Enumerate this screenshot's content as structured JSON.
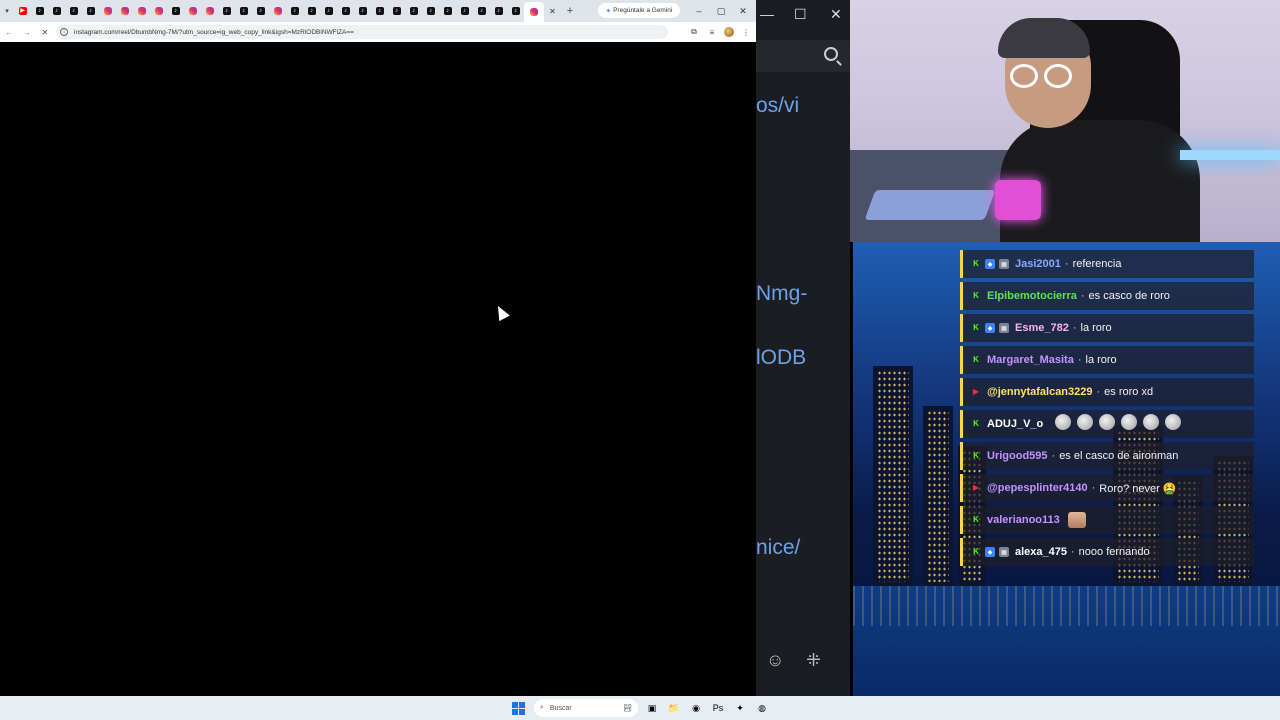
{
  "browser": {
    "tabs": [
      {
        "icon": "youtube"
      },
      {
        "icon": "tiktok"
      },
      {
        "icon": "tiktok"
      },
      {
        "icon": "tiktok"
      },
      {
        "icon": "tiktok"
      },
      {
        "icon": "instagram"
      },
      {
        "icon": "instagram"
      },
      {
        "icon": "instagram"
      },
      {
        "icon": "instagram"
      },
      {
        "icon": "tiktok"
      },
      {
        "icon": "instagram"
      },
      {
        "icon": "instagram"
      },
      {
        "icon": "tiktok"
      },
      {
        "icon": "tiktok"
      },
      {
        "icon": "tiktok"
      },
      {
        "icon": "instagram"
      },
      {
        "icon": "tiktok"
      },
      {
        "icon": "tiktok"
      },
      {
        "icon": "tiktok"
      },
      {
        "icon": "tiktok"
      },
      {
        "icon": "tiktok"
      },
      {
        "icon": "tiktok"
      },
      {
        "icon": "tiktok"
      },
      {
        "icon": "tiktok"
      },
      {
        "icon": "tiktok"
      },
      {
        "icon": "tiktok"
      },
      {
        "icon": "tiktok"
      },
      {
        "icon": "tiktok"
      },
      {
        "icon": "tiktok"
      },
      {
        "icon": "tiktok"
      },
      {
        "icon": "instagram",
        "active": true
      }
    ],
    "gemini_button": "Pregúntale a Gemini",
    "url": "instagram.com/reel/DbumbNmg-7M/?utm_source=ig_web_copy_link&igsh=MzRlODBiNWFlZA=="
  },
  "background_app": {
    "fragments": [
      "os/vi",
      "Nmg-",
      "lODB",
      "nice/"
    ]
  },
  "chat": [
    {
      "platform": "kick",
      "badges": [
        "blue",
        "x"
      ],
      "user": "Jasi2001",
      "color": "#8aa8ff",
      "text": "referencia"
    },
    {
      "platform": "kick",
      "badges": [],
      "user": "Elpibemotocierra",
      "color": "#5ee44e",
      "text": "es casco de roro"
    },
    {
      "platform": "kick",
      "badges": [
        "blue",
        "gray"
      ],
      "user": "Esme_782",
      "color": "#ffb0e8",
      "text": "la roro"
    },
    {
      "platform": "kick",
      "badges": [],
      "user": "Margaret_Masita",
      "color": "#c592ff",
      "text": "la roro"
    },
    {
      "platform": "youtube",
      "badges": [],
      "user": "@jennytafalcan3229",
      "color": "#ffe168",
      "text": "es roro xd"
    },
    {
      "platform": "kick",
      "badges": [],
      "user": "ADUJ_V_o",
      "color": "#ffffff",
      "text": "",
      "emotes": 6
    },
    {
      "platform": "kick",
      "badges": [],
      "user": "Urigood595",
      "color": "#c592ff",
      "text": "es el casco de aironman"
    },
    {
      "platform": "youtube",
      "badges": [],
      "user": "@pepesplinter4140",
      "color": "#c592ff",
      "text": "Roro? never 🤮"
    },
    {
      "platform": "kick",
      "badges": [],
      "user": "valerianoo113",
      "color": "#c592ff",
      "text": "",
      "face_emote": true
    },
    {
      "platform": "kick",
      "badges": [
        "blue",
        "gray"
      ],
      "user": "alexa_475",
      "color": "#ffffff",
      "text": "nooo fernando"
    }
  ],
  "taskbar": {
    "search_placeholder": "Buscar"
  }
}
